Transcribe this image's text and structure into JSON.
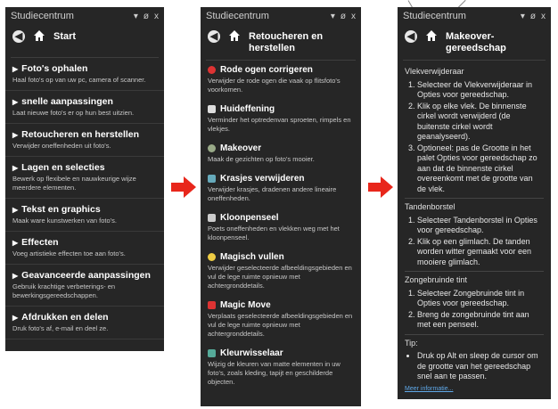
{
  "colors": {
    "panel_bg": "#262626",
    "arrow_red": "#e8261b",
    "link_blue": "#5fa8e8"
  },
  "panel1": {
    "title": "Studiecentrum",
    "controls": [
      "▾",
      "ø",
      "x"
    ],
    "nav_title": "Start",
    "items": [
      {
        "title": "Foto's ophalen",
        "desc": "Haal foto's op van uw pc, camera of scanner."
      },
      {
        "title": "snelle aanpassingen",
        "desc": "Laat nieuwe foto's er op hun best uitzien."
      },
      {
        "title": "Retoucheren en herstellen",
        "desc": "Verwijder oneffenheden uit foto's."
      },
      {
        "title": "Lagen en selecties",
        "desc": "Bewerk op flexibele en nauwkeurige wijze meerdere elementen."
      },
      {
        "title": "Tekst en graphics",
        "desc": "Maak ware kunstwerken van foto's."
      },
      {
        "title": "Effecten",
        "desc": "Voeg artistieke effecten toe aan foto's."
      },
      {
        "title": "Geavanceerde aanpassingen",
        "desc": "Gebruik krachtige verbeterings- en bewerkingsgereedschappen."
      },
      {
        "title": "Afdrukken en delen",
        "desc": "Druk foto's af, e-mail en deel ze."
      }
    ]
  },
  "panel2": {
    "title": "Studiecentrum",
    "controls": [
      "▾",
      "ø",
      "x"
    ],
    "nav_title": "Retoucheren en herstellen",
    "items": [
      {
        "title": "Rode ogen corrigeren",
        "desc": "Verwijder de rode ogen die vaak op flitsfoto's voorkomen.",
        "icon": "red-eye-icon"
      },
      {
        "title": "Huideffening",
        "desc": "Verminder het optredenvan sproeten, rimpels en vlekjes.",
        "icon": "skin-smooth-icon"
      },
      {
        "title": "Makeover",
        "desc": "Maak de gezichten op foto's mooier.",
        "icon": "makeover-icon"
      },
      {
        "title": "Krasjes verwijderen",
        "desc": "Verwijder krasjes, dradenen andere lineaire oneffenheden.",
        "icon": "scratch-icon"
      },
      {
        "title": "Kloonpenseel",
        "desc": "Poets oneffenheden en vlekken weg met het kloonpenseel.",
        "icon": "clone-brush-icon"
      },
      {
        "title": "Magisch vullen",
        "desc": "Verwijder geselecteerde afbeeldingsgebieden en vul de lege ruimte opnieuw met achtergronddetails.",
        "icon": "magic-fill-icon"
      },
      {
        "title": "Magic Move",
        "desc": "Verplaats geselecteerde afbeeldingsgebieden en vul de lege ruimte opnieuw met achtergronddetails.",
        "icon": "magic-move-icon"
      },
      {
        "title": "Kleurwisselaar",
        "desc": "Wijzig de kleuren van matte elementen in uw foto's, zoals kleding, tapijt en geschilderde objecten.",
        "icon": "color-changer-icon"
      }
    ]
  },
  "panel3": {
    "title": "Studiecentrum",
    "controls": [
      "▾",
      "ø",
      "x"
    ],
    "nav_title": "Makeover-gereedschap",
    "sections": [
      {
        "heading": "Vlekverwijderaar",
        "steps": [
          "Selecteer de Vlekverwijderaar in Opties voor gereedschap.",
          "Klik op elke vlek. De binnenste cirkel wordt verwijderd (de buitenste cirkel wordt geanalyseerd).",
          "Optioneel: pas de Grootte in het palet Opties voor gereedschap zo aan dat de binnenste cirkel overeenkomt met de grootte van de vlek."
        ]
      },
      {
        "heading": "Tandenborstel",
        "steps": [
          "Selecteer Tandenborstel in Opties voor gereedschap.",
          "Klik op een glimlach. De tanden worden witter gemaakt voor een mooiere glimlach."
        ]
      },
      {
        "heading": "Zongebruinde tint",
        "steps": [
          "Selecteer Zongebruinde tint in Opties voor gereedschap.",
          "Breng de zongebruinde tint aan met een penseel."
        ]
      }
    ],
    "tip_heading": "Tip:",
    "tip": "Druk op Alt en sleep de cursor om de grootte van het gereedschap snel aan te passen.",
    "more_link": "Meer informatie..."
  }
}
